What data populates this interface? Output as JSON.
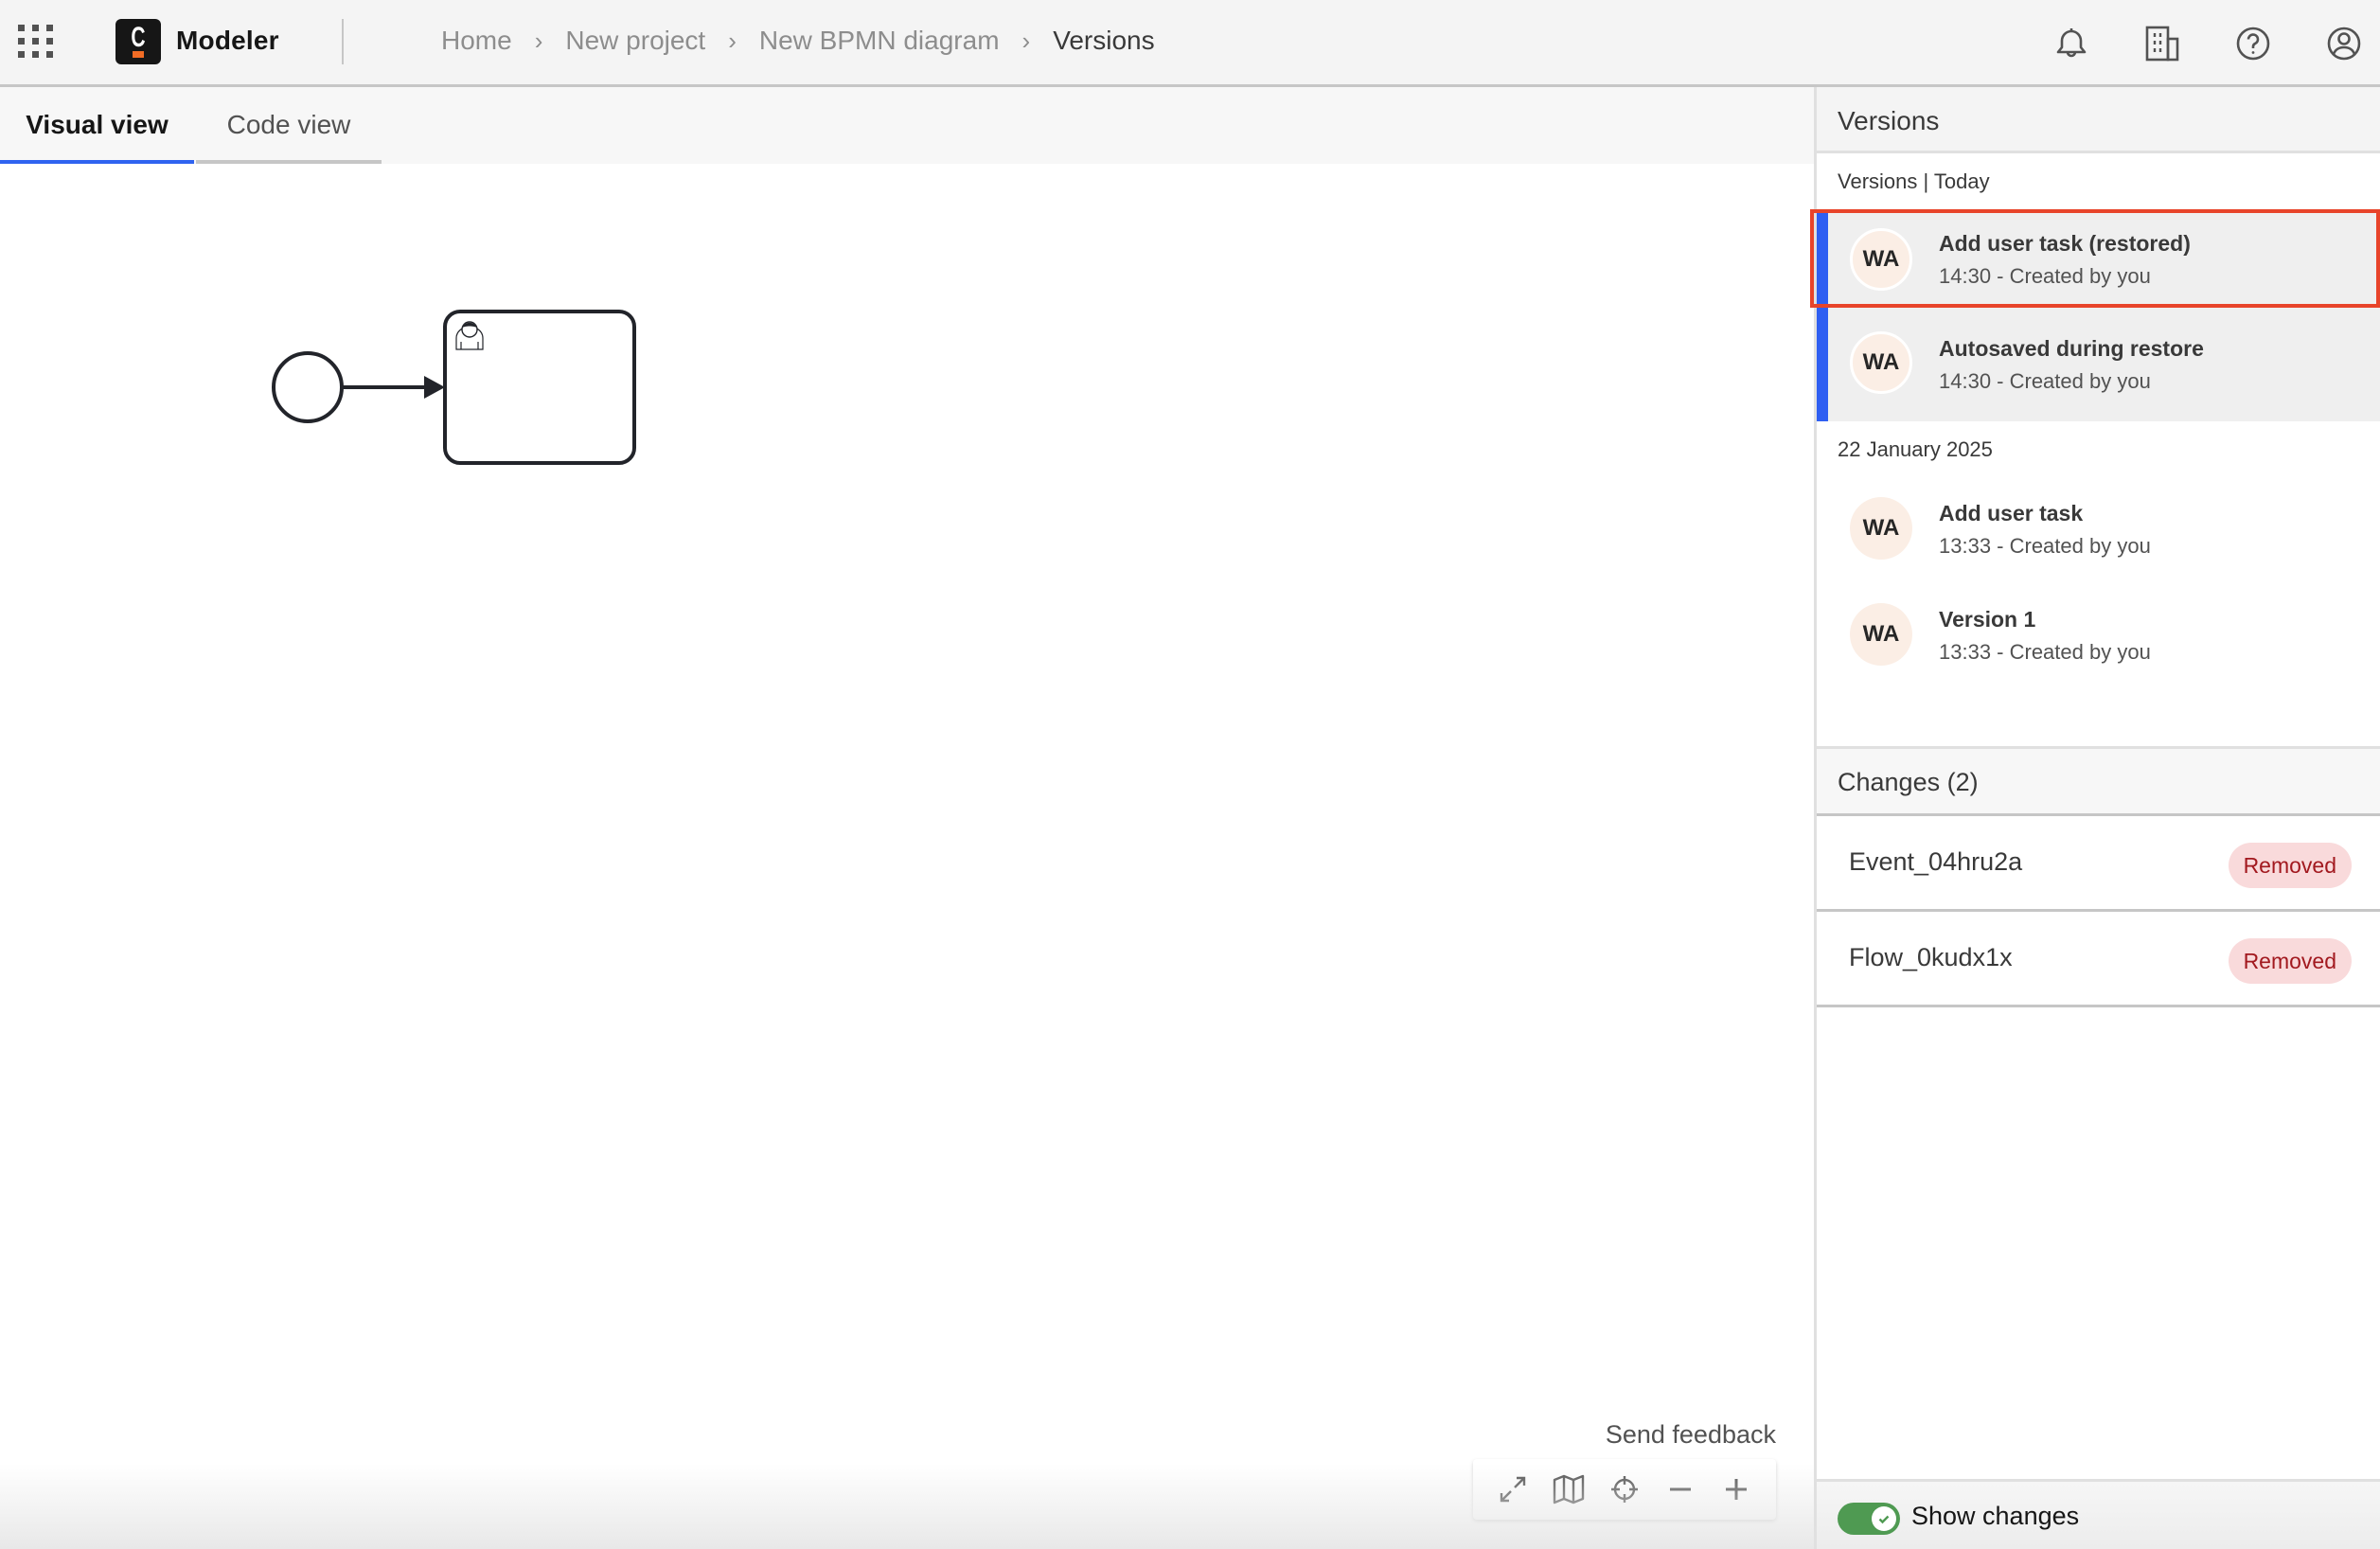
{
  "header": {
    "app_name": "Modeler",
    "logo_letter": "C",
    "breadcrumb": [
      {
        "label": "Home"
      },
      {
        "label": "New project"
      },
      {
        "label": "New BPMN diagram"
      },
      {
        "label": "Versions"
      }
    ],
    "breadcrumb_separator": "›",
    "icons": [
      "app-switcher-icon",
      "bell-icon",
      "organization-icon",
      "help-icon",
      "user-icon"
    ]
  },
  "tabs": [
    {
      "label": "Visual view",
      "active": true
    },
    {
      "label": "Code view",
      "active": false
    }
  ],
  "canvas": {
    "elements": [
      {
        "type": "start-event"
      },
      {
        "type": "sequence-flow"
      },
      {
        "type": "user-task",
        "label": ""
      }
    ],
    "send_feedback": "Send feedback",
    "controls": [
      "fullscreen-icon",
      "minimap-icon",
      "reset-view-icon",
      "zoom-out-icon",
      "zoom-in-icon"
    ]
  },
  "panel": {
    "title": "Versions",
    "groups": [
      {
        "label": "Versions | Today",
        "items": [
          {
            "initials": "WA",
            "title": "Add user task (restored)",
            "meta": "14:30 - Created by you",
            "selected": true,
            "highlighted": true
          },
          {
            "initials": "WA",
            "title": "Autosaved during restore",
            "meta": "14:30 - Created by you",
            "selected": true,
            "highlighted": false
          }
        ]
      },
      {
        "label": "22 January 2025",
        "items": [
          {
            "initials": "WA",
            "title": "Add user task",
            "meta": "13:33 - Created by you",
            "selected": false
          },
          {
            "initials": "WA",
            "title": "Version 1",
            "meta": "13:33 - Created by you",
            "selected": false
          }
        ]
      }
    ],
    "changes": {
      "title": "Changes (2)",
      "items": [
        {
          "name": "Event_04hru2a",
          "status": "Removed"
        },
        {
          "name": "Flow_0kudx1x",
          "status": "Removed"
        }
      ]
    },
    "footer": {
      "toggle_label": "Show changes",
      "toggle_on": true
    }
  },
  "colors": {
    "accent_blue": "#2f5ff2",
    "highlight_red": "#e8442a",
    "removed_badge_bg": "#f9dadb",
    "removed_badge_text": "#a2191f",
    "toggle_green": "#4f9a52",
    "logo_orange": "#f16c25"
  }
}
